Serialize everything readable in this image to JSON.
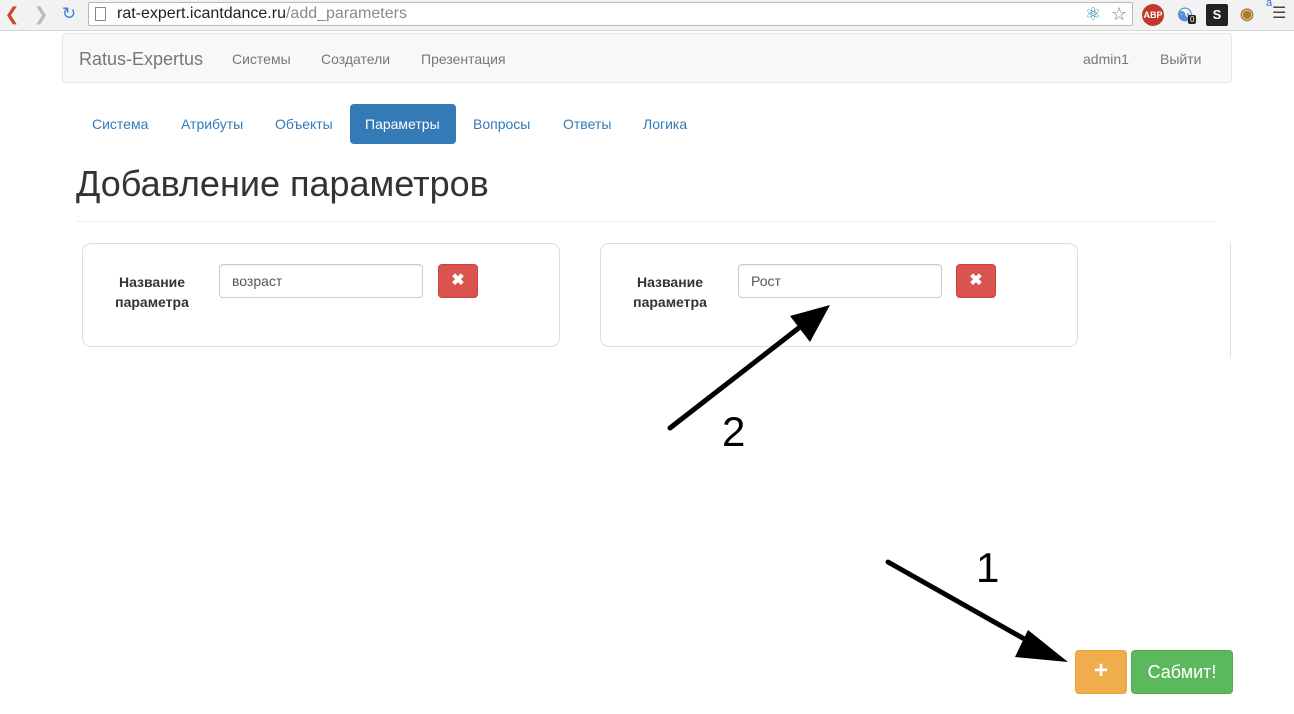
{
  "browser": {
    "url_host": "rat-expert.icantdance.ru",
    "url_path": "/add_parameters",
    "extensions": {
      "abp": "ABP",
      "ghost_badge": "0",
      "s_ext": "S",
      "menu_badge": "a"
    }
  },
  "navbar": {
    "brand": "Ratus-Expertus",
    "links": [
      "Системы",
      "Создатели",
      "Презентация"
    ],
    "user": "admin1",
    "logout": "Выйти"
  },
  "tabs": [
    {
      "label": "Система",
      "active": false
    },
    {
      "label": "Атрибуты",
      "active": false
    },
    {
      "label": "Объекты",
      "active": false
    },
    {
      "label": "Параметры",
      "active": true
    },
    {
      "label": "Вопросы",
      "active": false
    },
    {
      "label": "Ответы",
      "active": false
    },
    {
      "label": "Логика",
      "active": false
    }
  ],
  "page_title": "Добавление параметров",
  "parameters": [
    {
      "label": "Название параметра",
      "value": "возраст"
    },
    {
      "label": "Название параметра",
      "value": "Рост"
    }
  ],
  "annotations": [
    "2",
    "1"
  ],
  "actions": {
    "add": "+",
    "submit": "Сабмит!"
  },
  "colors": {
    "primary": "#337ab7",
    "danger": "#d9534f",
    "warning": "#f0ad4e",
    "success": "#5cb85c"
  }
}
